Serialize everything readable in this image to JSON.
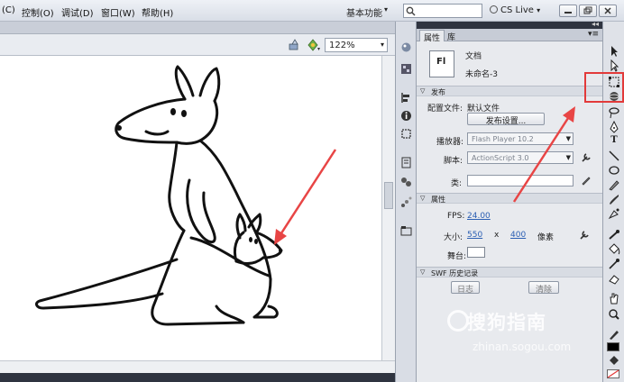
{
  "menu": {
    "items": [
      "(C)",
      "控制(O)",
      "调试(D)",
      "窗口(W)",
      "帮助(H)"
    ],
    "workspace_label": "基本功能",
    "search_placeholder": "",
    "cs_live": "CS Live"
  },
  "stage": {
    "zoom_value": "122%"
  },
  "panel": {
    "tabs": [
      "属性",
      "库"
    ],
    "doc_icon_label": "Fl",
    "doc_type": "文档",
    "doc_name": "未命名-3",
    "publish_section": "发布",
    "profile_label": "配置文件:",
    "profile_value": "默认文件",
    "publish_settings_button": "发布设置...",
    "player_label": "播放器:",
    "player_value": "Flash Player 10.2",
    "script_label": "脚本:",
    "script_value": "ActionScript 3.0",
    "class_label": "类:",
    "properties_section": "属性",
    "fps_label": "FPS:",
    "fps_value": "24.00",
    "size_label": "大小:",
    "width_value": "550",
    "size_x": "x",
    "height_value": "400",
    "units": "像素",
    "stage_color_label": "舞台:",
    "stage_color": "#ffffff",
    "swf_section": "SWF 历史记录",
    "log_button": "日志",
    "clear_button": "清除"
  },
  "watermark": {
    "cn": "搜狗指南",
    "en": "zhinan.sogou.com"
  },
  "colors": {
    "highlight": "#e23a3a",
    "arrow": "#e84545",
    "link": "#2b5fb3"
  }
}
